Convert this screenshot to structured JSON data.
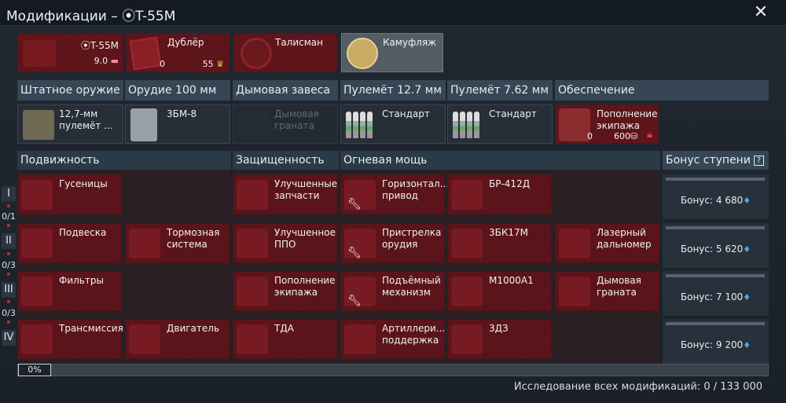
{
  "window": {
    "title": "Модификации – ⦿T-55M"
  },
  "top_slots": {
    "vehicle": {
      "name": "⦿T-55M",
      "rank": "9.0"
    },
    "backup": {
      "label": "Дублёр",
      "count": "0",
      "price": "55"
    },
    "talisman": {
      "label": "Талисман"
    },
    "camo": {
      "label": "Камуфляж"
    }
  },
  "categories": [
    "Штатное оружие",
    "Орудие 100 мм",
    "Дымовая завеса",
    "Пулемёт 12.7 мм",
    "Пулемёт 7.62 мм",
    "Обеспечение"
  ],
  "weapon_slots": {
    "mg": "12,7-мм пулемёт ...",
    "shell": "3БМ-8",
    "smoke": "Дымовая граната",
    "mg127": "Стандарт",
    "mg762": "Стандарт",
    "crew": {
      "label": "Пополнение экипажа",
      "count": "0",
      "price": "600"
    }
  },
  "groups": [
    "Подвижность",
    "Защищенность",
    "Огневая мощь"
  ],
  "bonus_header": "Бонус ступени",
  "help_glyph": "?",
  "tiers": [
    {
      "roman": "I",
      "count": "0/1"
    },
    {
      "roman": "II",
      "count": "0/3"
    },
    {
      "roman": "III",
      "count": "0/3"
    },
    {
      "roman": "IV",
      "count": ""
    }
  ],
  "mods": {
    "tracks": "Гусеницы",
    "suspension": "Подвеска",
    "brakes": "Тормозная система",
    "filters": "Фильтры",
    "transmission": "Трансмиссия",
    "engine": "Двигатель",
    "parts": "Улучшенные запчасти",
    "fps": "Улучшенное ППО",
    "crew_repl": "Пополнение экипажа",
    "tda": "ТДА",
    "hdrive": "Горизонтал... привод",
    "br412d": "БР-412Д",
    "zero": "Пристрелка орудия",
    "zbk17m": "3БК17М",
    "rangefinder": "Лазерный дальномер",
    "elevation": "Подъёмный механизм",
    "m1000a1": "М1000А1",
    "smoke_gren": "Дымовая граната",
    "artillery": "Артиллери... поддержка",
    "zdz": "3ДЗ"
  },
  "bonuses": [
    "Бонус: 4 680",
    "Бонус: 5 620",
    "Бонус: 7 100",
    "Бонус: 9 200"
  ],
  "progress": {
    "percent": "0%",
    "fraction": 0
  },
  "footer": "Исследование всех модификаций: 0 / 133 000",
  "icons": {
    "close": "close-icon",
    "gem": "research-point-icon",
    "lock": "lock-icon",
    "wrench": "wrench-icon"
  }
}
